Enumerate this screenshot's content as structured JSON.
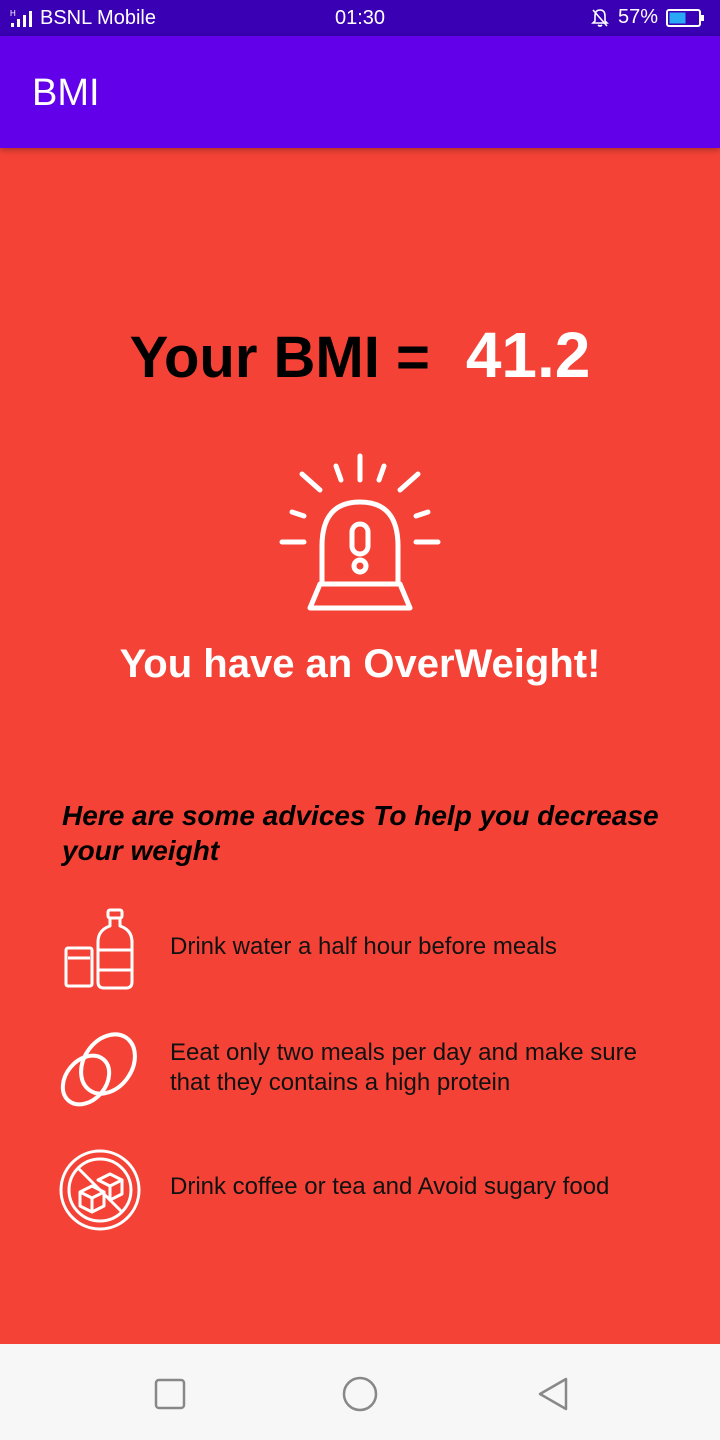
{
  "status_bar": {
    "carrier": "BSNL Mobile",
    "time": "01:30",
    "battery_percent": "57%",
    "battery_level": 0.57,
    "icons": [
      "signal-icon",
      "bell-muted-icon",
      "battery-icon"
    ]
  },
  "app_bar": {
    "title": "BMI",
    "color": "#6200ea"
  },
  "result": {
    "label": "Your BMI =",
    "value": "41.2",
    "verdict": "You have an OverWeight!",
    "icon": "alarm-siren-icon",
    "background": "#f44336"
  },
  "advice": {
    "heading": "Here are some advices To help you decrease your weight",
    "tips": [
      {
        "icon": "water-bottle-glass-icon",
        "text": "Drink water a half hour before meals"
      },
      {
        "icon": "eggs-icon",
        "text": "Eeat only two meals per day and make sure that they contains a high protein"
      },
      {
        "icon": "no-sugar-icon",
        "text": "Drink coffee or tea and Avoid sugary food"
      }
    ]
  },
  "nav_bar": {
    "buttons": [
      "recent-apps-icon",
      "home-icon",
      "back-icon"
    ]
  }
}
